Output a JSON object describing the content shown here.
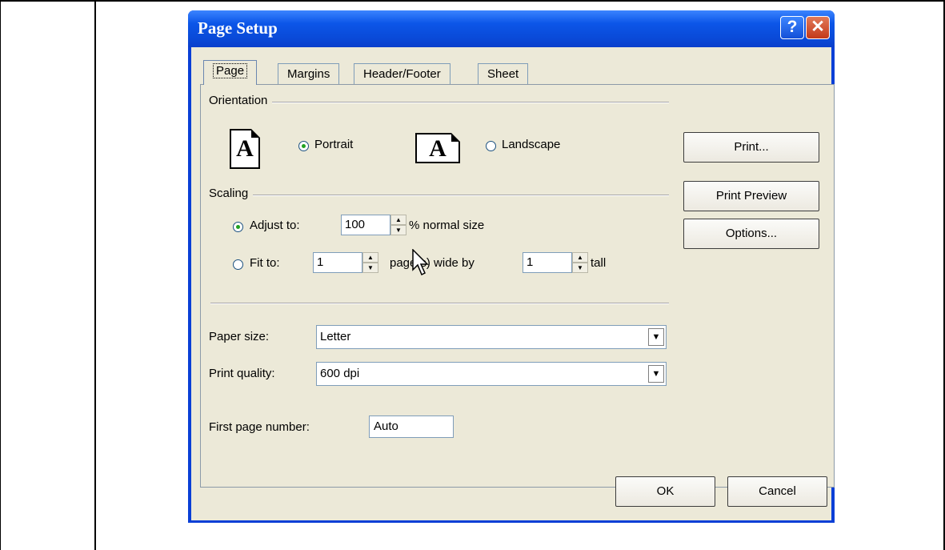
{
  "window": {
    "title": "Page Setup",
    "help_glyph": "?",
    "close_glyph": "✕"
  },
  "tabs": [
    {
      "label": "Page",
      "active": true
    },
    {
      "label": "Margins",
      "active": false
    },
    {
      "label": "Header/Footer",
      "active": false
    },
    {
      "label": "Sheet",
      "active": false
    }
  ],
  "orientation": {
    "group_label": "Orientation",
    "icon_glyph": "A",
    "portrait_label": "Portrait",
    "landscape_label": "Landscape",
    "selected": "Portrait"
  },
  "scaling": {
    "group_label": "Scaling",
    "adjust_label": "Adjust to:",
    "adjust_value": "100",
    "adjust_suffix": "% normal size",
    "fit_label": "Fit to:",
    "fit_wide_value": "1",
    "fit_wide_suffix": "page(s) wide by",
    "fit_tall_value": "1",
    "fit_tall_suffix": "tall",
    "selected": "Adjust to"
  },
  "paper_size": {
    "label": "Paper size:",
    "value": "Letter"
  },
  "print_quality": {
    "label": "Print quality:",
    "value": "600 dpi"
  },
  "first_page_number": {
    "label": "First page number:",
    "value": "Auto"
  },
  "side_buttons": {
    "print": "Print...",
    "print_preview": "Print Preview",
    "options": "Options..."
  },
  "footer_buttons": {
    "ok": "OK",
    "cancel": "Cancel"
  },
  "colors": {
    "titlebar": "#0a4ad8",
    "dialog_face": "#ece9d8",
    "radio_dot": "#21a121"
  }
}
